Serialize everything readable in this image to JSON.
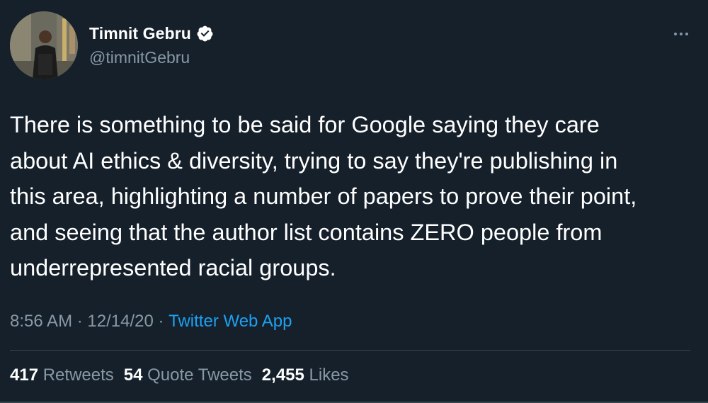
{
  "author": {
    "display_name": "Timnit Gebru",
    "handle": "@timnitGebru",
    "verified": true
  },
  "tweet": {
    "text": "There is something to be said for Google saying they care\nabout AI ethics & diversity, trying to say they're publishing in\nthis area, highlighting a number of papers to prove their point,\nand seeing that the author list contains ZERO people from\nunderrepresented racial groups."
  },
  "meta": {
    "time": "8:56 AM",
    "separator": " · ",
    "date": "12/14/20",
    "source": "Twitter Web App"
  },
  "stats": {
    "retweets_count": "417",
    "retweets_label": "Retweets",
    "quotes_count": "54",
    "quotes_label": "Quote Tweets",
    "likes_count": "2,455",
    "likes_label": "Likes"
  },
  "icons": {
    "verified": "verified-badge-icon",
    "more": "more-options-icon"
  },
  "colors": {
    "background": "#15202b",
    "secondary_text": "#8899a6",
    "accent": "#1da1f2",
    "divider": "#38444d"
  }
}
